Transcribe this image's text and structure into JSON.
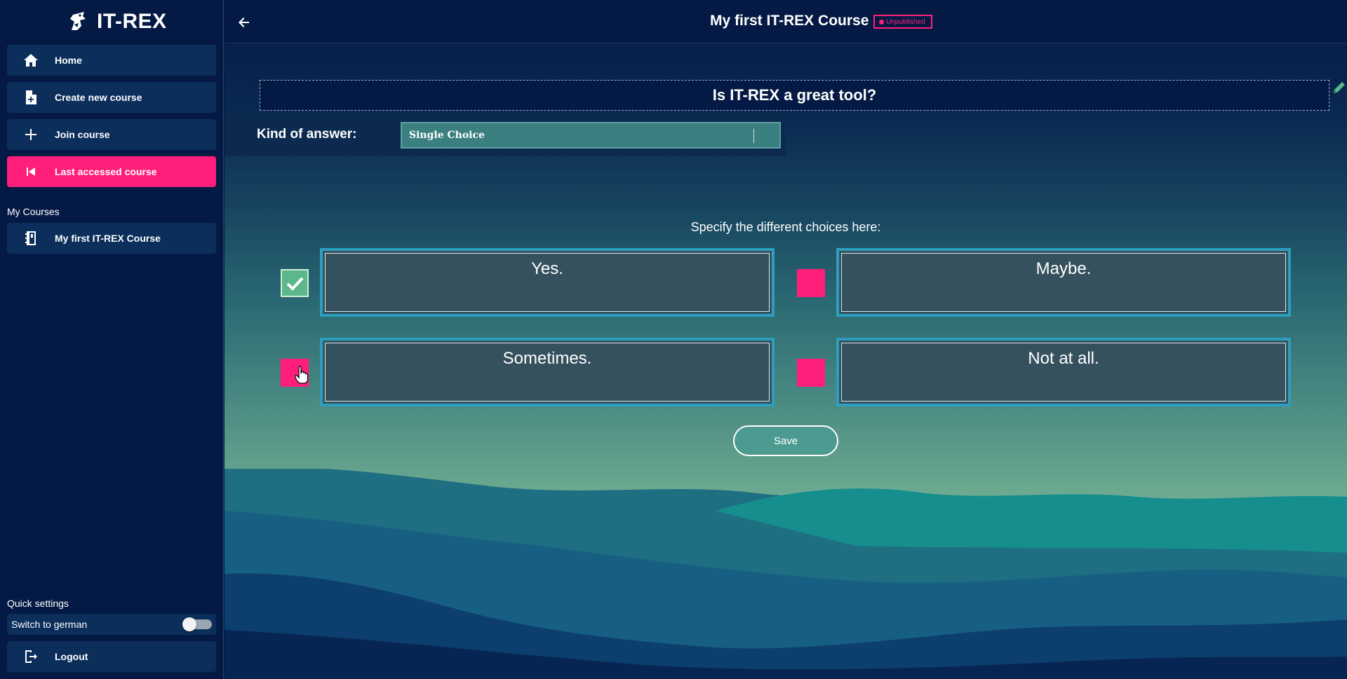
{
  "app": {
    "name": "IT-REX"
  },
  "sidebar": {
    "nav": [
      {
        "label": "Home",
        "icon": "home-icon"
      },
      {
        "label": "Create new course",
        "icon": "file-plus-icon"
      },
      {
        "label": "Join course",
        "icon": "plus-icon"
      },
      {
        "label": "Last accessed course",
        "icon": "skip-back-icon",
        "active": true
      }
    ],
    "my_courses_label": "My Courses",
    "courses": [
      {
        "label": "My first IT-REX Course",
        "icon": "notebook-icon"
      }
    ],
    "quick_settings_label": "Quick settings",
    "switch_german_label": "Switch to german",
    "switch_german_on": false,
    "logout_label": "Logout"
  },
  "header": {
    "course_title": "My first IT-REX Course",
    "status": "Unpublished"
  },
  "editor": {
    "question": "Is IT-REX a great tool?",
    "kind_label": "Kind of answer:",
    "kind_value": "Single Choice",
    "choices_heading": "Specify the different choices here:",
    "choices": [
      {
        "text": "Yes.",
        "checked": true
      },
      {
        "text": "Maybe.",
        "checked": false
      },
      {
        "text": "Sometimes.",
        "checked": false
      },
      {
        "text": "Not at all.",
        "checked": false
      }
    ],
    "save_label": "Save"
  },
  "colors": {
    "accent_pink": "#ff1f7a",
    "sidebar_bg": "#041a44",
    "nav_item_bg": "#0b2e5b",
    "checked_green": "#5cb88a",
    "field_border": "#2c9fbf"
  }
}
